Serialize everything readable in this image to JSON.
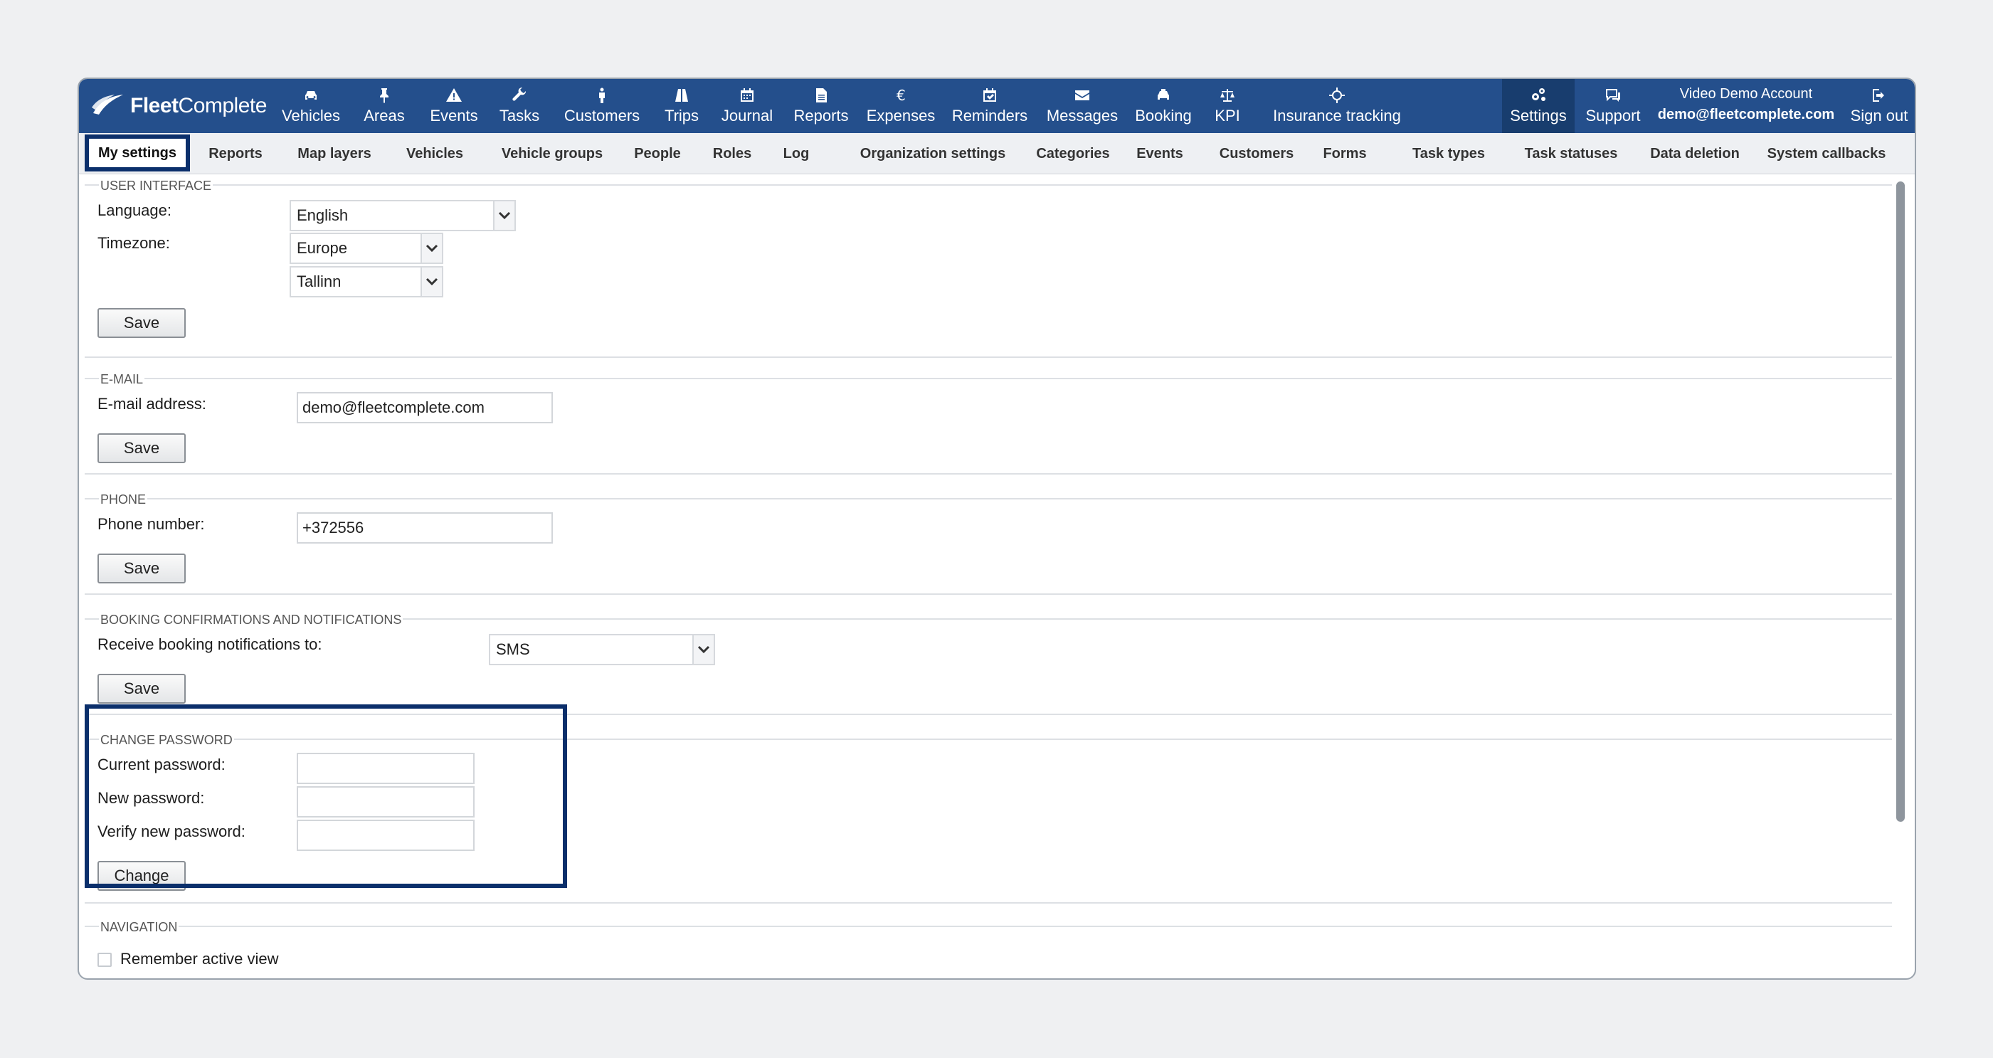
{
  "brand": {
    "name_bold": "Fleet",
    "name_regular": "Complete"
  },
  "nav": [
    {
      "label": "Vehicles",
      "icon": "car-icon"
    },
    {
      "label": "Areas",
      "icon": "pin-icon"
    },
    {
      "label": "Events",
      "icon": "warning-icon"
    },
    {
      "label": "Tasks",
      "icon": "wrench-icon"
    },
    {
      "label": "Customers",
      "icon": "person-icon"
    },
    {
      "label": "Trips",
      "icon": "road-icon"
    },
    {
      "label": "Journal",
      "icon": "calendar-icon"
    },
    {
      "label": "Reports",
      "icon": "document-icon"
    },
    {
      "label": "Expenses",
      "icon": "euro-icon"
    },
    {
      "label": "Reminders",
      "icon": "calendar-check-icon"
    },
    {
      "label": "Messages",
      "icon": "envelope-icon"
    },
    {
      "label": "Booking",
      "icon": "taxi-icon"
    },
    {
      "label": "KPI",
      "icon": "scale-icon"
    },
    {
      "label": "Insurance tracking",
      "icon": "crosshair-icon"
    },
    {
      "label": "Settings",
      "icon": "gears-icon"
    },
    {
      "label": "Support",
      "icon": "chat-icon"
    },
    {
      "label": "Sign out",
      "icon": "sign-out-icon"
    }
  ],
  "account": {
    "name": "Video Demo Account",
    "email": "demo@fleetcomplete.com"
  },
  "tabs": [
    "My settings",
    "Reports",
    "Map layers",
    "Vehicles",
    "Vehicle groups",
    "People",
    "Roles",
    "Log",
    "Organization settings",
    "Categories",
    "Events",
    "Customers",
    "Forms",
    "Task types",
    "Task statuses",
    "Data deletion",
    "System callbacks"
  ],
  "sections": {
    "ui": {
      "title": "USER INTERFACE",
      "language_label": "Language:",
      "language_value": "English",
      "timezone_label": "Timezone:",
      "timezone_region": "Europe",
      "timezone_city": "Tallinn",
      "save": "Save"
    },
    "email": {
      "title": "E-MAIL",
      "label": "E-mail address:",
      "value": "demo@fleetcomplete.com",
      "save": "Save"
    },
    "phone": {
      "title": "PHONE",
      "label": "Phone number:",
      "value": "+372556",
      "save": "Save"
    },
    "booking": {
      "title": "BOOKING CONFIRMATIONS AND NOTIFICATIONS",
      "label": "Receive booking notifications to:",
      "value": "SMS",
      "save": "Save"
    },
    "password": {
      "title": "CHANGE PASSWORD",
      "current_label": "Current password:",
      "new_label": "New password:",
      "verify_label": "Verify new password:",
      "change": "Change"
    },
    "navigation": {
      "title": "NAVIGATION",
      "remember_label": "Remember active view"
    }
  }
}
